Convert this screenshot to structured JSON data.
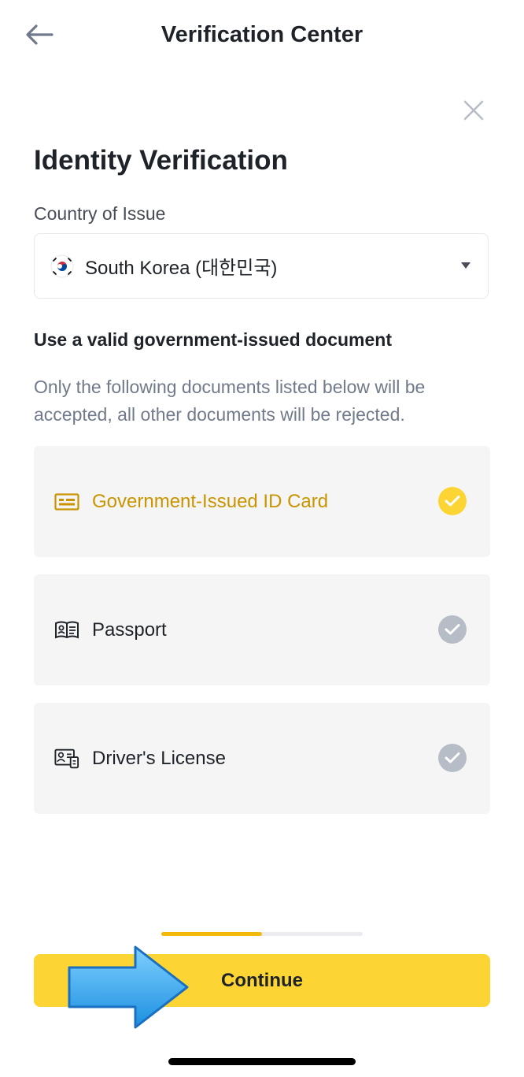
{
  "header": {
    "title": "Verification Center",
    "back_icon": "arrow-left-icon"
  },
  "dialog": {
    "close_icon": "close-icon",
    "title": "Identity Verification",
    "country_label": "Country of Issue",
    "country_value": "South Korea (대한민국)",
    "country_flag": "south-korea-flag-icon",
    "documents_heading": "Use a valid government-issued document",
    "documents_description": "Only the following documents listed below will be accepted, all other documents will be rejected.",
    "documents": [
      {
        "label": "Government-Issued ID Card",
        "icon": "id-card-icon",
        "selected": true
      },
      {
        "label": "Passport",
        "icon": "passport-icon",
        "selected": false
      },
      {
        "label": "Driver's License",
        "icon": "drivers-license-icon",
        "selected": false
      }
    ]
  },
  "progress": {
    "fraction": 0.5
  },
  "actions": {
    "continue_label": "Continue"
  },
  "colors": {
    "accent": "#fcd535",
    "selected_text": "#c99400",
    "check_inactive": "#b7bdc6",
    "option_bg": "#f5f5f5"
  }
}
